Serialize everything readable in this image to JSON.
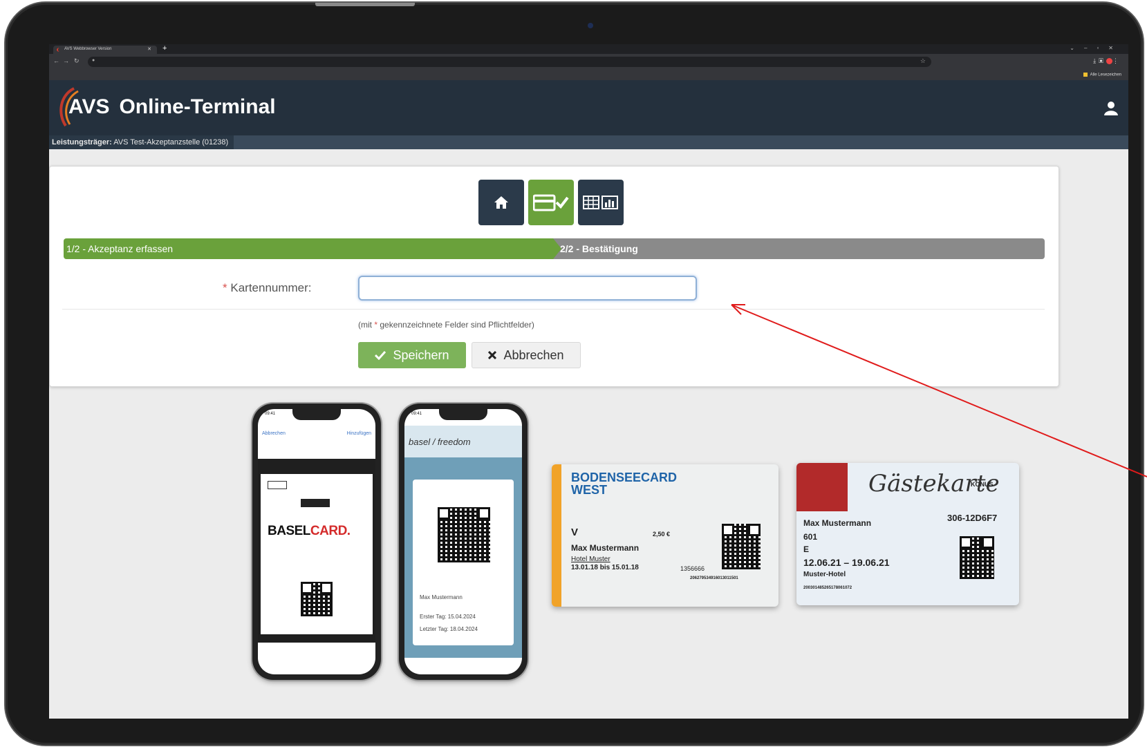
{
  "browser": {
    "tab_title": "AVS Webbrowser Version",
    "bookmarks_label": "Alle Lesezeichen",
    "nav_icons": [
      "back-icon",
      "forward-icon",
      "reload-icon"
    ]
  },
  "header": {
    "logo": "AVS",
    "title": "Online-Terminal",
    "user_icon": "user-icon"
  },
  "subheader": {
    "label": "Leistungsträger:",
    "value": "AVS Test-Akzeptanzstelle (01238)"
  },
  "toolbar": {
    "icons": [
      "home-icon",
      "card-check-icon",
      "table-chart-icon"
    ]
  },
  "steps": {
    "step1": "1/2 - Akzeptanz erfassen",
    "step2": "2/2 - Bestätigung"
  },
  "form": {
    "required_mark": "*",
    "card_label": "Kartennummer:",
    "card_value": "",
    "hint_prefix": "(mit",
    "hint_star": "*",
    "hint_suffix": "gekennzeichnete Felder sind Pflichtfelder)",
    "save_label": "Speichern",
    "cancel_label": "Abbrechen"
  },
  "examples": {
    "phone1": {
      "time": "09:41",
      "left_link": "Abbrechen",
      "right_link": "Hinzufügen",
      "card_title": "BASELCARD.",
      "card_title_plain": "BASEL",
      "card_title_accent": "CARD."
    },
    "phone2": {
      "time": "09:41",
      "brand": "basel / freedom",
      "line1": "Max Mustermann",
      "line2": "Erster Tag: 15.04.2024",
      "line3": "Letzter Tag: 18.04.2024"
    },
    "bodensee": {
      "title_line1": "BODENSEECARD",
      "title_line2": "WEST",
      "category": "V",
      "price": "2,50 €",
      "name": "Max Mustermann",
      "hotel": "Hotel Muster",
      "dates": "13.01.18 bis 15.01.18",
      "number": "1356666",
      "barcode_num": "206279534916013011501"
    },
    "gaeste": {
      "title": "Gästekarte",
      "brand": "KONUS",
      "name": "Max Mustermann",
      "code": "306-12D6F7",
      "room": "601",
      "category": "E",
      "dates": "12.06.21 – 19.06.21",
      "hotel": "Muster-Hotel",
      "barcode_num": "200301485265178061072"
    }
  },
  "colors": {
    "header_bg": "#24303d",
    "accent_green": "#6aa13b",
    "step_inactive": "#8a8a8a",
    "annotation_arrow": "#e01b1b"
  }
}
